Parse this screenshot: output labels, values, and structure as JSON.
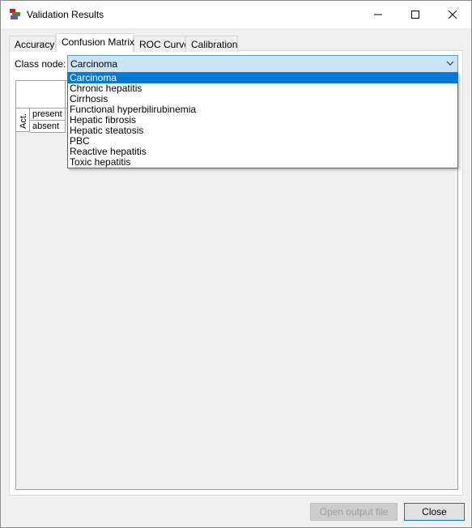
{
  "window": {
    "title": "Validation Results",
    "controls": [
      "minimize-icon",
      "maximize-icon",
      "close-icon"
    ]
  },
  "tabs": [
    {
      "label": "Accuracy",
      "active": false
    },
    {
      "label": "Confusion Matrix",
      "active": true
    },
    {
      "label": "ROC Curve",
      "active": false
    },
    {
      "label": "Calibration",
      "active": false
    }
  ],
  "class_node": {
    "label": "Class node:",
    "selected": "Carcinoma",
    "options": [
      "Carcinoma",
      "Chronic hepatitis",
      "Cirrhosis",
      "Functional hyperbilirubinemia",
      "Hepatic fibrosis",
      "Hepatic steatosis",
      "PBC",
      "Reactive hepatitis",
      "Toxic hepatitis"
    ]
  },
  "matrix": {
    "row_group_label": "Act.",
    "rows": [
      "present",
      "absent"
    ]
  },
  "buttons": {
    "open_output": "Open output file",
    "close": "Close"
  },
  "colors": {
    "selection": "#0078d7",
    "combo_bg": "#cce4f7"
  }
}
